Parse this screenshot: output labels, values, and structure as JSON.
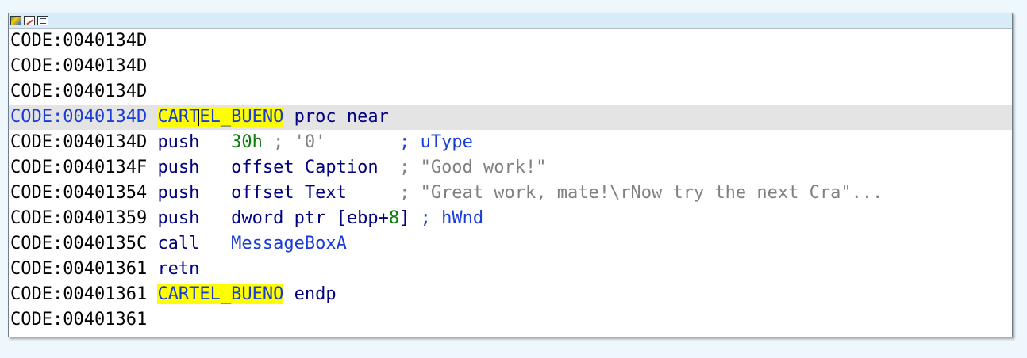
{
  "titlebar": {
    "icons": [
      "graph-view-icon",
      "edit-icon",
      "list-view-icon"
    ]
  },
  "lines": [
    {
      "addr": "CODE:0040134D"
    },
    {
      "addr": "CODE:0040134D"
    },
    {
      "addr": "CODE:0040134D"
    },
    {
      "addr": "CODE:0040134D",
      "label_a": "CART",
      "label_b": "EL_BUENO",
      "directive": "proc near"
    },
    {
      "addr": "CODE:0040134D",
      "mnem": "push   ",
      "num": "30h",
      "cmt": " ; '0'       ",
      "cmt2": "; uType"
    },
    {
      "addr": "CODE:0040134F",
      "mnem": "push   ",
      "operand": "offset Caption",
      "cmt": "  ; \"Good work!\""
    },
    {
      "addr": "CODE:00401354",
      "mnem": "push   ",
      "operand": "offset Text",
      "cmt": "     ; \"Great work, mate!\\rNow try the next Cra\"..."
    },
    {
      "addr": "CODE:00401359",
      "mnem": "push   ",
      "op_a": "dword ptr [ebp+",
      "num": "8",
      "op_b": "]",
      "cmt2": " ; hWnd"
    },
    {
      "addr": "CODE:0040135C",
      "mnem": "call   ",
      "target": "MessageBoxA"
    },
    {
      "addr": "CODE:00401361",
      "mnem": "retn"
    },
    {
      "addr": "CODE:00401361",
      "label": "CARTEL_BUENO",
      "directive": "endp"
    },
    {
      "addr": "CODE:00401361"
    }
  ],
  "colors": {
    "highlight": "#ffff00",
    "current_line": "#e4e4e4",
    "number": "#0a7a0a",
    "comment": "#808080",
    "name": "#1a3cd8"
  }
}
